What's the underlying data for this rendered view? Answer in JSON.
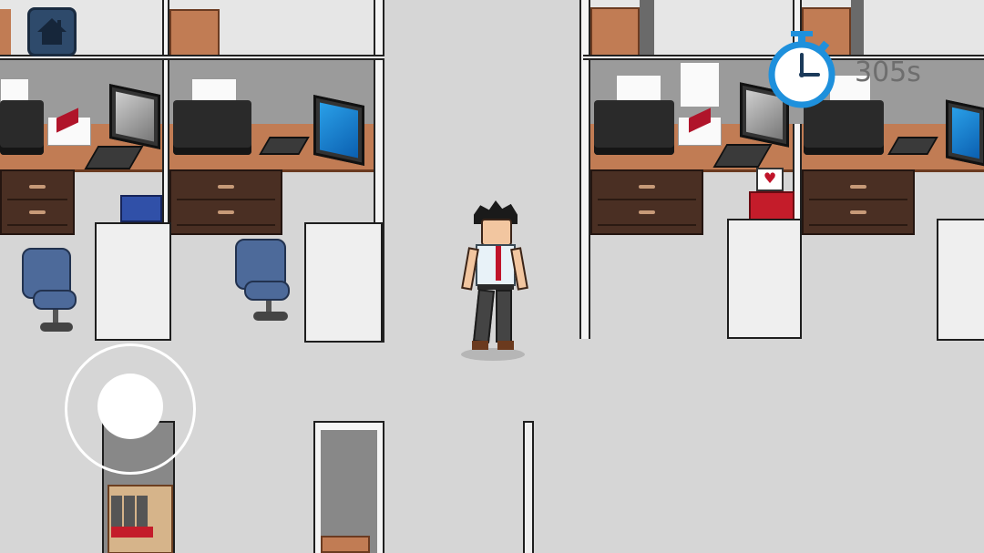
{
  "hud": {
    "timer_text": "305s",
    "timer_icon": "stopwatch-icon",
    "home_icon": "home-icon"
  },
  "controls": {
    "joystick": "virtual-joystick"
  },
  "colors": {
    "accent_blue": "#1e90dc",
    "desk": "#c17c54",
    "drawer": "#4a2f23",
    "chair": "#4d6a9a",
    "tie": "#c0142a"
  }
}
